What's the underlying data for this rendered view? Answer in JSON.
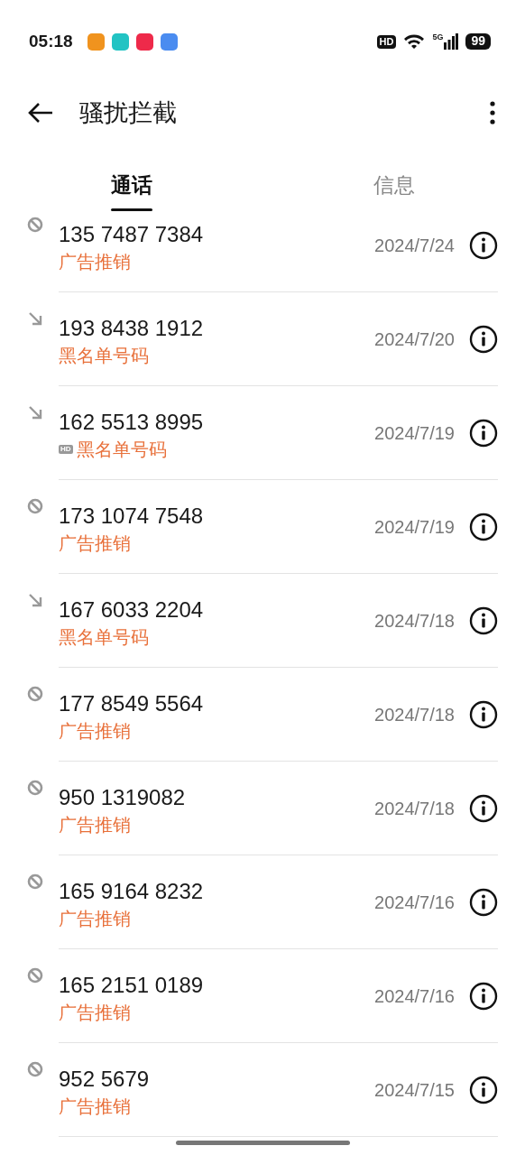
{
  "status_bar": {
    "time": "05:18",
    "apps": [
      {
        "color": "#f0931e"
      },
      {
        "color": "#22c3c3"
      },
      {
        "color": "#ee2a4a"
      },
      {
        "color": "#4a8cf0"
      }
    ],
    "hd": "HD",
    "network": "5G",
    "battery": "99"
  },
  "header": {
    "title": "骚扰拦截"
  },
  "tabs": [
    {
      "label": "通话",
      "selected": true
    },
    {
      "label": "信息",
      "selected": false
    }
  ],
  "calls": [
    {
      "kind": "blocked",
      "number": "135 7487 7384",
      "tag": "广告推销",
      "date": "2024/7/24"
    },
    {
      "kind": "incoming",
      "number": "193 8438 1912",
      "tag": "黑名单号码",
      "date": "2024/7/20"
    },
    {
      "kind": "incoming",
      "number": "162 5513 8995",
      "badge": "HD",
      "tag": "黑名单号码",
      "date": "2024/7/19"
    },
    {
      "kind": "blocked",
      "number": "173 1074 7548",
      "tag": "广告推销",
      "date": "2024/7/19"
    },
    {
      "kind": "incoming",
      "number": "167 6033 2204",
      "tag": "黑名单号码",
      "date": "2024/7/18"
    },
    {
      "kind": "blocked",
      "number": "177 8549 5564",
      "tag": "广告推销",
      "date": "2024/7/18"
    },
    {
      "kind": "blocked",
      "number": "950 1319082",
      "tag": "广告推销",
      "date": "2024/7/18"
    },
    {
      "kind": "blocked",
      "number": "165 9164 8232",
      "tag": "广告推销",
      "date": "2024/7/16"
    },
    {
      "kind": "blocked",
      "number": "165 2151 0189",
      "tag": "广告推销",
      "date": "2024/7/16"
    },
    {
      "kind": "blocked",
      "number": "952 5679",
      "tag": "广告推销",
      "date": "2024/7/15"
    }
  ]
}
